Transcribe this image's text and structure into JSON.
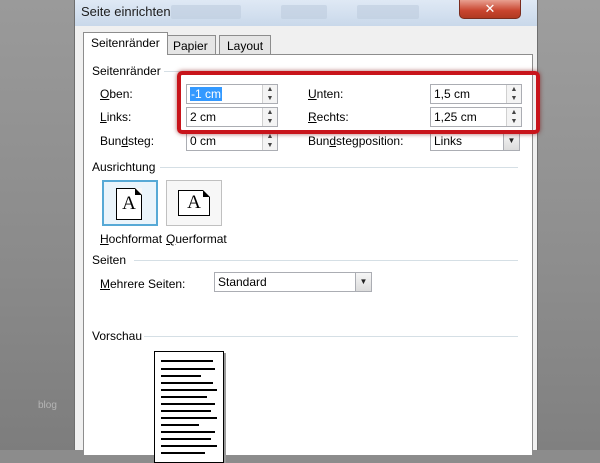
{
  "window": {
    "title": "Seite einrichten"
  },
  "tabs": [
    {
      "label": "Seitenränder",
      "active": true
    },
    {
      "label": "Papier",
      "active": false
    },
    {
      "label": "Layout",
      "active": false
    }
  ],
  "margins": {
    "group_label": "Seitenränder",
    "top": {
      "label_key": "O",
      "label_rest": "ben:",
      "value": "-1 cm"
    },
    "bottom": {
      "label_key": "U",
      "label_rest": "nten:",
      "value": "1,5 cm"
    },
    "left": {
      "label_key": "L",
      "label_rest": "inks:",
      "value": "2 cm"
    },
    "right": {
      "label_key": "R",
      "label_rest": "echts:",
      "value": "1,25 cm"
    },
    "gutter": {
      "label_pre": "Bun",
      "label_key": "d",
      "label_rest": "steg:",
      "value": "0 cm"
    },
    "gutter_position": {
      "label_pre": "Bun",
      "label_key": "d",
      "label_rest": "stegposition:",
      "value": "Links"
    }
  },
  "orientation": {
    "group_label": "Ausrichtung",
    "portrait": {
      "label_key": "H",
      "label_rest": "ochformat",
      "glyph": "A",
      "selected": true
    },
    "landscape": {
      "label_key": "Q",
      "label_rest": "uerformat",
      "glyph": "A",
      "selected": false
    }
  },
  "pages": {
    "group_label": "Seiten",
    "multiple_pages": {
      "label_key": "M",
      "label_rest": "ehrere Seiten:",
      "value": "Standard"
    }
  },
  "preview": {
    "group_label": "Vorschau"
  },
  "watermark": "blog",
  "colors": {
    "highlight": "#c8141b",
    "selection": "#3399ff",
    "close_button": "#c8442e"
  }
}
